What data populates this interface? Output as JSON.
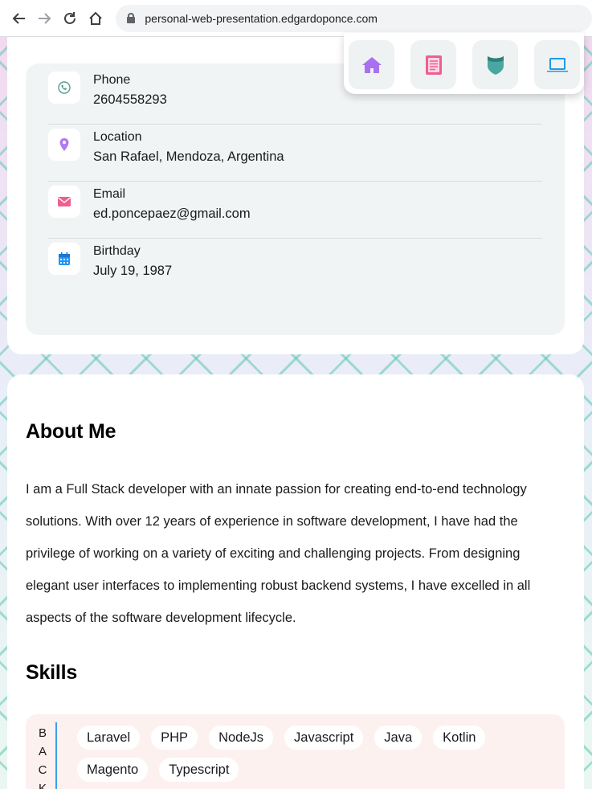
{
  "browser": {
    "url": "personal-web-presentation.edgardoponce.com"
  },
  "nav": {
    "items": [
      {
        "icon": "home-icon",
        "color": "#a970f0"
      },
      {
        "icon": "document-icon",
        "color": "#ee5f8f"
      },
      {
        "icon": "shield-icon",
        "color": "#4aa6a0"
      },
      {
        "icon": "laptop-icon",
        "color": "#1f9ae6"
      }
    ]
  },
  "contact": {
    "items": [
      {
        "label": "Phone",
        "value": "2604558293",
        "icon": "phone-icon",
        "color": "#5a9b8e"
      },
      {
        "label": "Location",
        "value": "San Rafael, Mendoza, Argentina",
        "icon": "location-pin-icon",
        "color": "#b27af0"
      },
      {
        "label": "Email",
        "value": "ed.poncepaez@gmail.com",
        "icon": "envelope-icon",
        "color": "#ee5f8f"
      },
      {
        "label": "Birthday",
        "value": "July 19, 1987",
        "icon": "calendar-icon",
        "color": "#2196f3"
      }
    ]
  },
  "about": {
    "title": "About Me",
    "text": "I am a Full Stack developer with an innate passion for creating end-to-end technology solutions. With over 12 years of experience in software development, I have had the privilege of working on a variety of exciting and challenging projects. From designing elegant user interfaces to implementing robust backend systems, I have excelled in all aspects of the software development lifecycle."
  },
  "skills": {
    "title": "Skills",
    "category_letters": [
      "B",
      "A",
      "C",
      "K"
    ],
    "items": [
      "Laravel",
      "PHP",
      "NodeJs",
      "Javascript",
      "Java",
      "Kotlin",
      "Magento",
      "Typescript"
    ]
  }
}
